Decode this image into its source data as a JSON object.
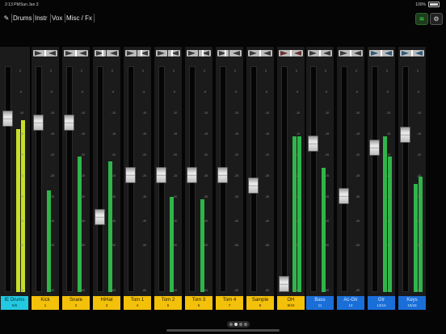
{
  "status": {
    "time": "2:13 PM",
    "date": "Sun Jan 3",
    "battery": "100%"
  },
  "toolbar": {
    "tabs": [
      {
        "label": "Drums"
      },
      {
        "label": "Instr"
      },
      {
        "label": "Vox"
      },
      {
        "label": "Misc / Fx"
      }
    ]
  },
  "channels": [
    {
      "name": "IE Drums",
      "num": "5/6",
      "color": "cyan",
      "fader": 0.79,
      "m1": 0.72,
      "m2": 0.76,
      "pan": "center"
    },
    {
      "name": "Kick",
      "num": "1",
      "color": "yellow",
      "fader": 0.77,
      "m1": 0.45,
      "m2": 0.0,
      "pan": "center"
    },
    {
      "name": "Snare",
      "num": "2",
      "color": "yellow",
      "fader": 0.77,
      "m1": 0.6,
      "m2": 0.0,
      "pan": "center"
    },
    {
      "name": "HiHat",
      "num": "3",
      "color": "yellow",
      "fader": 0.32,
      "m1": 0.58,
      "m2": 0.0,
      "pan": "left"
    },
    {
      "name": "Tom 1",
      "num": "4",
      "color": "yellow",
      "fader": 0.52,
      "m1": 0.0,
      "m2": 0.0,
      "pan": "right"
    },
    {
      "name": "Tom 2",
      "num": "5",
      "color": "yellow",
      "fader": 0.52,
      "m1": 0.42,
      "m2": 0.0,
      "pan": "right"
    },
    {
      "name": "Tom 3",
      "num": "6",
      "color": "yellow",
      "fader": 0.52,
      "m1": 0.41,
      "m2": 0.0,
      "pan": "right"
    },
    {
      "name": "Tom 4",
      "num": "7",
      "color": "yellow",
      "fader": 0.52,
      "m1": 0.0,
      "m2": 0.0,
      "pan": "left"
    },
    {
      "name": "Sample",
      "num": "8",
      "color": "yellow",
      "fader": 0.47,
      "m1": 0.0,
      "m2": 0.0,
      "pan": "center"
    },
    {
      "name": "OH",
      "num": "9/10",
      "color": "yellow",
      "fader": 0.0,
      "m1": 0.69,
      "m2": 0.69,
      "pan": "red"
    },
    {
      "name": "Bass",
      "num": "11",
      "color": "blue",
      "fader": 0.67,
      "m1": 0.55,
      "m2": 0.0,
      "pan": "center"
    },
    {
      "name": "Ac-Gtr",
      "num": "12",
      "color": "blue",
      "fader": 0.42,
      "m1": 0.0,
      "m2": 0.0,
      "pan": "center"
    },
    {
      "name": "Gtr",
      "num": "13/14",
      "color": "blue",
      "fader": 0.65,
      "m1": 0.69,
      "m2": 0.6,
      "pan": "blue"
    },
    {
      "name": "Keys",
      "num": "15/16",
      "color": "blue",
      "fader": 0.71,
      "m1": 0.48,
      "m2": 0.51,
      "pan": "blue"
    }
  ],
  "scale_labels": [
    "0",
    "-5",
    "-10",
    "-15",
    "-20",
    "-25",
    "-30",
    "-40",
    "-50",
    "-60"
  ],
  "colors": {
    "cyan": "#22c9e0",
    "yellow": "#f3c00a",
    "blue": "#1a6ed8",
    "meter": "#2fb54a"
  },
  "icons": {
    "edit": "pencil-icon",
    "wifi": "wifi-icon",
    "settings": "gear-icon"
  },
  "page_dots": {
    "count": 4,
    "active": 1
  }
}
